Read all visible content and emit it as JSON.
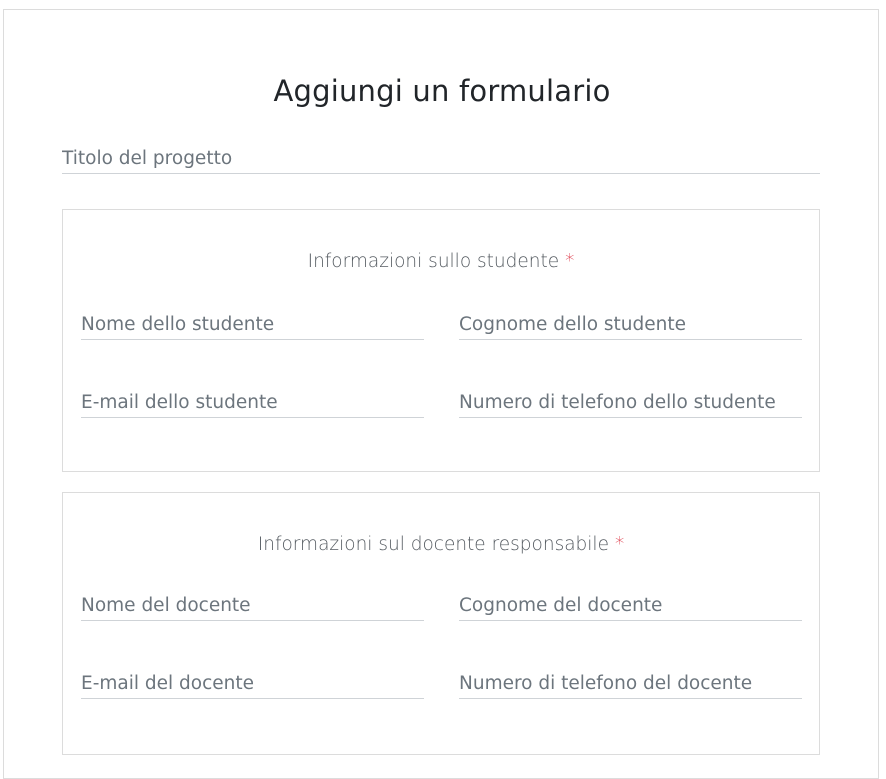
{
  "form": {
    "title": "Aggiungi un formulario",
    "project_title_placeholder": "Titolo del progetto"
  },
  "student_section": {
    "legend": "Informazioni sullo studente",
    "required_mark": "*",
    "first_name_placeholder": "Nome dello studente",
    "last_name_placeholder": "Cognome dello studente",
    "email_placeholder": "E-mail dello studente",
    "phone_placeholder": "Numero di telefono dello studente"
  },
  "teacher_section": {
    "legend": "Informazioni sul docente responsabile",
    "required_mark": "*",
    "first_name_placeholder": "Nome del docente",
    "last_name_placeholder": "Cognome del docente",
    "email_placeholder": "E-mail del docente",
    "phone_placeholder": "Numero di telefono del docente"
  },
  "colors": {
    "required": "#dc3545",
    "border": "#dcdcdc",
    "placeholder": "#6c757d"
  }
}
